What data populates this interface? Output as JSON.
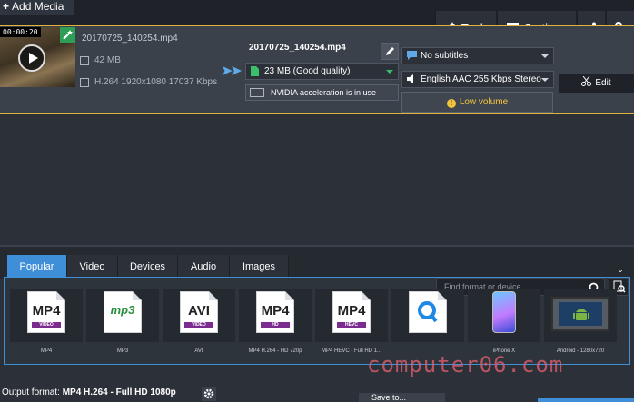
{
  "app": {
    "add_media": "Add Media",
    "tools": "Tools",
    "settings": "Settings"
  },
  "file": {
    "timecode": "00:00:20",
    "source_name": "20170725_140254.mp4",
    "source_size": "42 MB",
    "source_info": "H.264 1920x1080 17037 Kbps",
    "output_name": "20170725_140254.mp4",
    "output_size": "23 MB (Good quality)",
    "nvidia": "NVIDIA acceleration is in use",
    "subtitles": "No subtitles",
    "audio": "English AAC 255 Kbps Stereo",
    "low_volume": "Low volume",
    "edit": "Edit"
  },
  "format_tabs": [
    "Popular",
    "Video",
    "Devices",
    "Audio",
    "Images"
  ],
  "search_placeholder": "Find format or device...",
  "formats": [
    {
      "big": "MP4",
      "band": "VIDEO",
      "label": "MP4",
      "band_color": "#7b2c8e"
    },
    {
      "big": "mp3",
      "band": "",
      "label": "MP3",
      "band_color": "#2a8f3e"
    },
    {
      "big": "AVI",
      "band": "VIDEO",
      "label": "AVI",
      "band_color": "#7b2c8e"
    },
    {
      "big": "MP4",
      "band": "HD",
      "label": "MP4 H.264 - HD 720p",
      "band_color": "#7b2c8e"
    },
    {
      "big": "MP4",
      "band": "HEVC",
      "label": "MP4 HEVC - Full HD 1...",
      "band_color": "#7b2c8e"
    },
    {
      "big": "",
      "band": "",
      "label": "",
      "band_color": "#1e88e5"
    },
    {
      "big": "",
      "band": "",
      "label": "iPhone X",
      "band_color": "#999999"
    },
    {
      "big": "",
      "band": "",
      "label": "Android - 1280x720",
      "band_color": "#7cb342"
    }
  ],
  "output": {
    "prefix": "Output format:",
    "value": "MP4 H.264 - Full HD 1080p",
    "save": "Save to..."
  },
  "watermark": "computer06.com",
  "colors": {
    "accent": "#3e8fd8",
    "highlight": "#e0b43a",
    "warning": "#f2c43d"
  }
}
